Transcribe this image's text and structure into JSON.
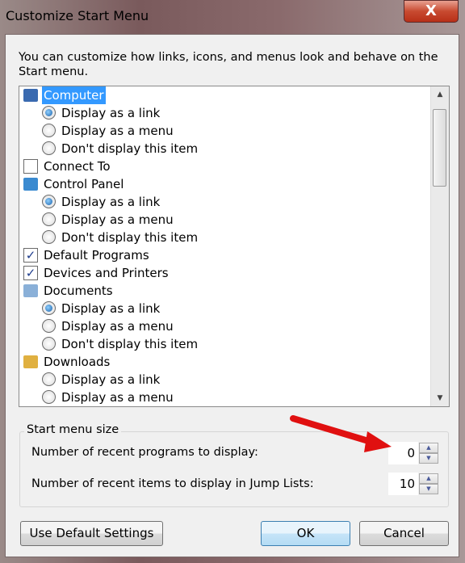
{
  "window": {
    "title": "Customize Start Menu",
    "close_label": "X"
  },
  "description": "You can customize how links, icons, and menus look and behave on the Start menu.",
  "list": [
    {
      "type": "header",
      "icon": "computer-icon",
      "label": "Computer",
      "selected": true
    },
    {
      "type": "radio",
      "label": "Display as a link",
      "checked": true
    },
    {
      "type": "radio",
      "label": "Display as a menu",
      "checked": false
    },
    {
      "type": "radio",
      "label": "Don't display this item",
      "checked": false
    },
    {
      "type": "checkbox",
      "label": "Connect To",
      "checked": false
    },
    {
      "type": "header",
      "icon": "control-panel-icon",
      "label": "Control Panel"
    },
    {
      "type": "radio",
      "label": "Display as a link",
      "checked": true
    },
    {
      "type": "radio",
      "label": "Display as a menu",
      "checked": false
    },
    {
      "type": "radio",
      "label": "Don't display this item",
      "checked": false
    },
    {
      "type": "checkbox",
      "label": "Default Programs",
      "checked": true
    },
    {
      "type": "checkbox",
      "label": "Devices and Printers",
      "checked": true
    },
    {
      "type": "header",
      "icon": "documents-icon",
      "label": "Documents"
    },
    {
      "type": "radio",
      "label": "Display as a link",
      "checked": true
    },
    {
      "type": "radio",
      "label": "Display as a menu",
      "checked": false
    },
    {
      "type": "radio",
      "label": "Don't display this item",
      "checked": false
    },
    {
      "type": "header",
      "icon": "downloads-icon",
      "label": "Downloads"
    },
    {
      "type": "radio",
      "label": "Display as a link",
      "checked": false
    },
    {
      "type": "radio",
      "label": "Display as a menu",
      "checked": false
    }
  ],
  "size_group": {
    "title": "Start menu size",
    "recent_programs_label": "Number of recent programs to display:",
    "recent_programs_value": "0",
    "jump_list_label": "Number of recent items to display in Jump Lists:",
    "jump_list_value": "10"
  },
  "buttons": {
    "defaults": "Use Default Settings",
    "ok": "OK",
    "cancel": "Cancel"
  },
  "colors": {
    "selection": "#3399ff",
    "annotation_arrow": "#e01010"
  }
}
